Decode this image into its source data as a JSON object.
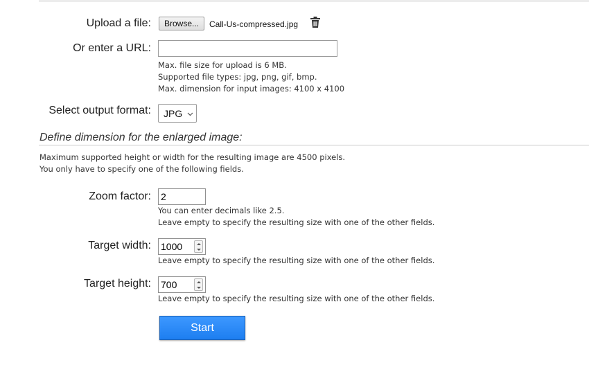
{
  "upload": {
    "label": "Upload a file:",
    "browse_label": "Browse...",
    "filename": "Call-Us-compressed.jpg",
    "delete_icon": "trash-icon"
  },
  "url": {
    "label": "Or enter a URL:",
    "value": ""
  },
  "upload_info": {
    "lines": [
      "Max. file size for upload is 6 MB.",
      "Supported file types: jpg, png, gif, bmp.",
      "Max. dimension for input images: 4100 x 4100"
    ]
  },
  "output_format": {
    "label": "Select output format:",
    "selected": "JPG"
  },
  "dimensions": {
    "heading": "Define dimension for the enlarged image:",
    "intro_lines": [
      "Maximum supported height or width for the resulting image are 4500 pixels.",
      "You only have to specify one of the following fields."
    ]
  },
  "zoom": {
    "label": "Zoom factor:",
    "value": "2",
    "hint_lines": [
      "You can enter decimals like 2.5.",
      "Leave empty to specify the resulting size with one of the other fields."
    ]
  },
  "target_width": {
    "label": "Target width:",
    "value": "1000",
    "hint": "Leave empty to specify the resulting size with one of the other fields."
  },
  "target_height": {
    "label": "Target height:",
    "value": "700",
    "hint": "Leave empty to specify the resulting size with one of the other fields."
  },
  "start_label": "Start",
  "colors": {
    "start_button": "#2384f5",
    "rule": "#c8c8c8"
  }
}
